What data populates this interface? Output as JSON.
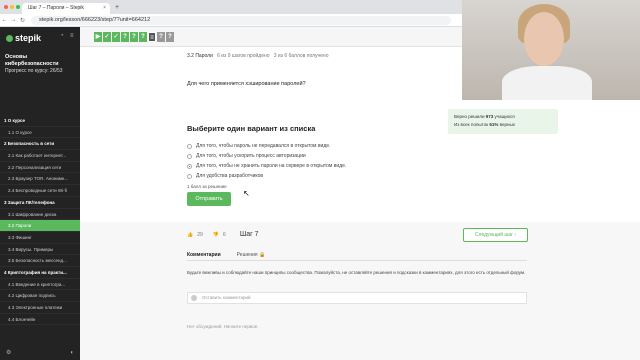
{
  "browser": {
    "tab_title": "Шаг 7 – Пароли – Stepik",
    "url": "stepik.org/lesson/666223/step/7?unit=664212"
  },
  "sidebar": {
    "logo": "stepik",
    "course_title": "Основы кибербезопасности",
    "progress": "Прогресс по курсу:  26/53",
    "items": [
      {
        "label": "1  О курсе",
        "type": "section"
      },
      {
        "label": "1.1  О курсе",
        "type": "item"
      },
      {
        "label": "2  Безопасность в сети",
        "type": "section"
      },
      {
        "label": "2.1  Как работает интернет...",
        "type": "item"
      },
      {
        "label": "2.2  Персонализация сети",
        "type": "item"
      },
      {
        "label": "2.3  Браузер TOR. Анонимн...",
        "type": "item"
      },
      {
        "label": "2.4  Беспроводные сети Wi-fi",
        "type": "item"
      },
      {
        "label": "3  Защита ПК/телефона",
        "type": "section"
      },
      {
        "label": "3.1  Шифрование диска",
        "type": "item"
      },
      {
        "label": "3.2  Пароли",
        "type": "active"
      },
      {
        "label": "3.3  Фишинг",
        "type": "item"
      },
      {
        "label": "3.4  Вирусы. Примеры",
        "type": "item"
      },
      {
        "label": "3.5  Безопасность мессенд...",
        "type": "item"
      },
      {
        "label": "4  Криптография на практи...",
        "type": "section"
      },
      {
        "label": "4.1  Введение в криптогра...",
        "type": "item"
      },
      {
        "label": "4.2  Цифровая подпись",
        "type": "item"
      },
      {
        "label": "4.3  Электронные платежи",
        "type": "item"
      },
      {
        "label": "4.4  Блокчейн",
        "type": "item"
      }
    ]
  },
  "lesson": {
    "step_label": "3.2 Пароли",
    "steps_done": "6 из 9 шагов пройдено",
    "points": "3 из 6 баллов  получено",
    "question": "Для чего применяется хэширование паролей?",
    "chooser_title": "Выберите один вариант из списка",
    "stats_line1_pre": "Верно решили ",
    "stats_count": "973",
    "stats_line1_post": " учащихся",
    "stats_line2_pre": "Из всех попыток ",
    "stats_pct": "61%",
    "stats_line2_post": " верных",
    "options": [
      {
        "text": "Для того, чтобы пароль не передавался в открытом виде.",
        "selected": false
      },
      {
        "text": "Для того, чтобы ускорить процесс авторизации",
        "selected": false
      },
      {
        "text": "Для того, чтобы не хранить пароли на сервере в открытом виде.",
        "selected": true
      },
      {
        "text": "Для удобства разработчиков",
        "selected": false
      }
    ],
    "score_note": "1 балл за решение",
    "submit_label": "Отправить"
  },
  "footer": {
    "likes": "29",
    "dislikes": "6",
    "step_name": "Шаг 7",
    "next_label": "Следующий шаг",
    "tab_comments": "Комментарии",
    "tab_solutions": "Решения",
    "rules": "Будьте вежливы и соблюдайте наши принципы сообщества. Пожалуйста, не оставляйте решения и подсказки в комментариях, для этого есть отдельный форум.",
    "comment_placeholder": "Оставить комментарий",
    "no_discussions": "Нет обсуждений. Начните первое."
  },
  "colors": {
    "accent": "#5cb85c",
    "sidebar_bg": "#232324"
  }
}
